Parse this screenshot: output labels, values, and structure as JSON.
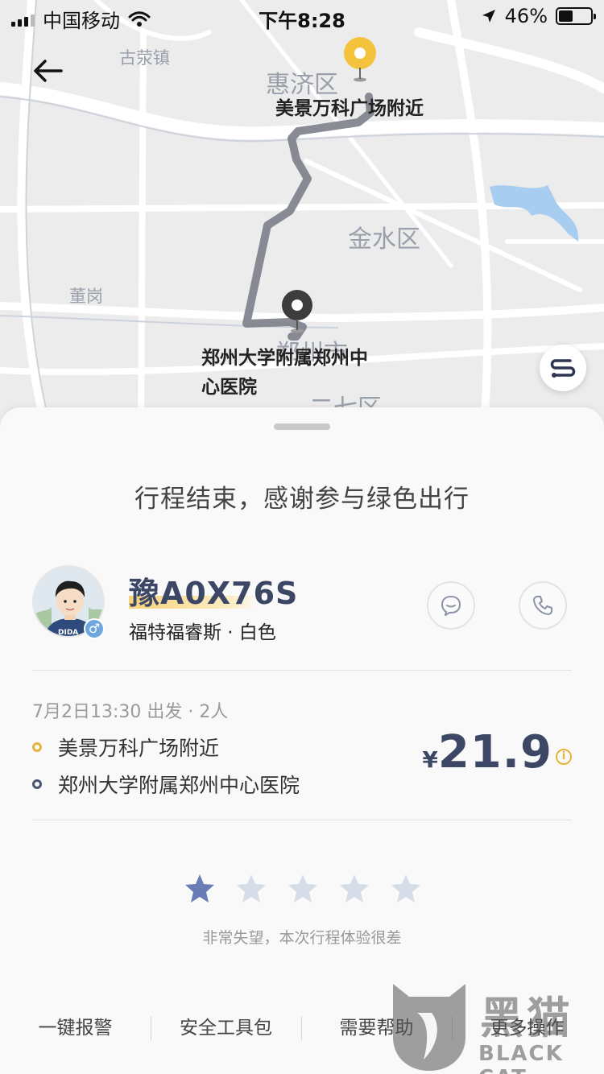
{
  "status_bar": {
    "carrier": "中国移动",
    "time": "下午8:28",
    "battery_percent": "46%",
    "battery_level": 0.46
  },
  "map": {
    "districts": [
      "古荥镇",
      "惠济区",
      "金水区",
      "董岗",
      "郑州市",
      "二七区"
    ],
    "pickup_label": "美景万科广场附近",
    "dropoff_label_line1": "郑州大学附属郑州中",
    "dropoff_label_line2": "心医院",
    "colors": {
      "pickup_pin": "#f5c23d",
      "dropoff_pin": "#3d3d3d",
      "route": "#7d7f8a",
      "water": "#a7cdf0"
    }
  },
  "trip": {
    "title": "行程结束，感谢参与绿色出行",
    "driver": {
      "plate": "豫A0X76S",
      "car": "福特福睿斯 · 白色",
      "avatar_text": "DIDA",
      "gender_symbol": "♂"
    },
    "meta": "7月2日13:30 出发 · 2人",
    "from": "美景万科广场附近",
    "to": "郑州大学附属郑州中心医院",
    "price_symbol": "¥",
    "price": "21.9",
    "info_symbol": "i"
  },
  "rating": {
    "stars_total": 5,
    "stars_selected": 1,
    "text": "非常失望，本次行程体验很差",
    "colors": {
      "active": "#6a7bb5",
      "inactive": "#d7dde8"
    }
  },
  "actions": [
    "一键报警",
    "安全工具包",
    "需要帮助",
    "更多操作"
  ],
  "watermark": {
    "cn": "黑猫",
    "en": "BLACK CAT"
  }
}
